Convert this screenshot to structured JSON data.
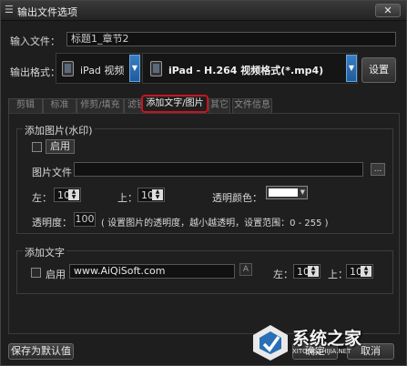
{
  "window": {
    "title": "输出文件选项",
    "close_label": "✕"
  },
  "input_file": {
    "label": "输入文件：",
    "value": "标题1_章节2"
  },
  "output_format": {
    "label": "输出格式：",
    "device": "iPad 视频",
    "format": "iPad - H.264 视频格式(*.mp4)",
    "settings_label": "设置"
  },
  "tabs": [
    {
      "label": "剪辑"
    },
    {
      "label": "标准"
    },
    {
      "label": "修剪/填充"
    },
    {
      "label": "滤镜"
    },
    {
      "label": "添加文字/图片"
    },
    {
      "label": "其它"
    },
    {
      "label": "文件信息"
    }
  ],
  "image_group": {
    "title": "添加图片(水印)",
    "enable_label": "启用",
    "file_label": "图片文件：",
    "browse_label": "...",
    "left_label": "左：",
    "left_value": "10",
    "top_label": "上：",
    "top_value": "10",
    "transparent_color_label": "透明颜色：",
    "opacity_label": "透明度：",
    "opacity_value": "100",
    "opacity_hint": "( 设置图片的透明度，越小越透明，设置范围：0 - 255 )"
  },
  "text_group": {
    "title": "添加文字",
    "enable_label": "启用",
    "text_value": "www.AiQiSoft.com",
    "font_btn": "A",
    "left_label": "左：",
    "left_value": "10",
    "top_label": "上：",
    "top_value": "10"
  },
  "buttons": {
    "save_default": "保存为默认值",
    "ok": "确定",
    "cancel": "取消"
  },
  "watermark": {
    "text": "系统之家",
    "sub": "XITONGZHIJIA.NET"
  }
}
